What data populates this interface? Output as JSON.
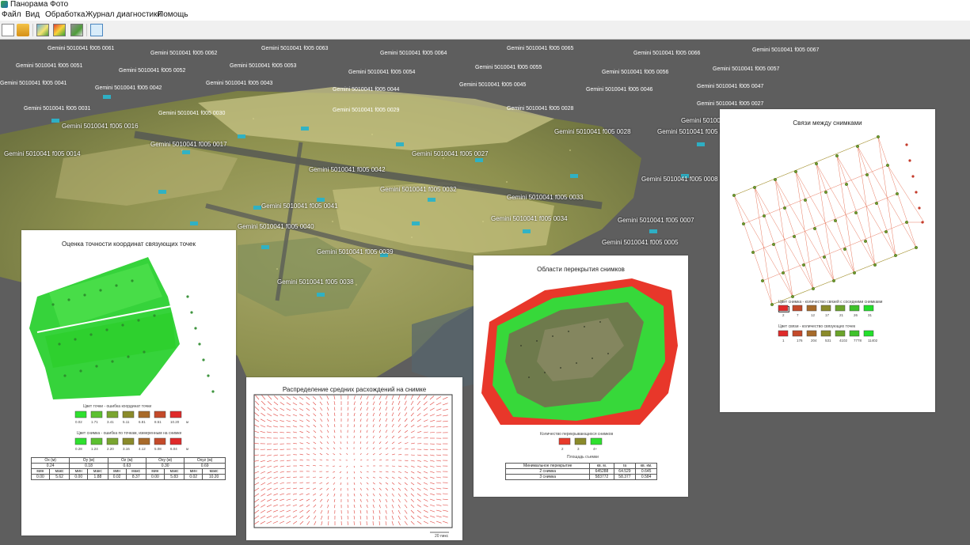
{
  "window": {
    "title": "Панорама Фото"
  },
  "menu": [
    "Файл",
    "Вид",
    "Обработка",
    "Журнал диагностики",
    "Помощь"
  ],
  "toolbar": {
    "icons": [
      "new-document-icon",
      "open-folder-icon",
      "image-tool-icon",
      "color-map-icon",
      "image-process-icon",
      "window-icon"
    ]
  },
  "scene": {
    "camera_labels": [
      "Gemini 5010041 f005 0041",
      "Gemini 5010041 f005 0042",
      "Gemini 5010041 f005 0040",
      "Gemini 5010041 f005 0039",
      "Gemini 5010041 f005 0038",
      "Gemini 5010041 f005 0032",
      "Gemini 5010041 f005 0033",
      "Gemini 5010041 f005 0034",
      "Gemini 5010041 f005 0007",
      "Gemini 5010041 f005 0006",
      "Gemini 5010041 f005 0005",
      "Gemini 5010041 f005 0008",
      "Gemini 5010041 f005 0027",
      "Gemini 5010041 f005 0028",
      "Gemini 5010041 f005 0029",
      "Gemini 5010041 f005 0016",
      "Gemini 5010041 f005 0017",
      "Gemini 5010041 f005 0018",
      "Gemini 5010041 f005 0014",
      "Gemini 5010041 f005 0013"
    ]
  },
  "report_links": {
    "title": "Связи между снимками",
    "legend1_caption": "Цвет снимка - количество связей с соседними снимками",
    "legend1_colors": [
      "#e02a2a",
      "#c44a2a",
      "#a66a2a",
      "#8a8a2a",
      "#6aa42a",
      "#3ec22a",
      "#22e02a"
    ],
    "legend1_values": [
      "2",
      "7",
      "12",
      "17",
      "21",
      "26",
      "31"
    ],
    "legend2_caption": "Цвет связи - количество связующих точек",
    "legend2_colors": [
      "#e02a2a",
      "#c44a2a",
      "#a66a2a",
      "#8a8a2a",
      "#6aa42a",
      "#3ec22a",
      "#22e02a"
    ],
    "legend2_values": [
      "1",
      "176",
      "204",
      "531",
      "4102",
      "7778",
      "11402"
    ]
  },
  "report_accuracy": {
    "title": "Оценка точности координат связующих точек",
    "legend1_caption": "Цвет точки - ошибка координат точки",
    "legend1_colors": [
      "#2ee02e",
      "#5cc030",
      "#7aa530",
      "#8a8a2a",
      "#a86a2a",
      "#c44a2a",
      "#e02a2a"
    ],
    "legend1_values": [
      "0.02",
      "1.71",
      "3.41",
      "5.11",
      "6.81",
      "8.51",
      "10.20",
      "м"
    ],
    "legend2_caption": "Цвет снимка - ошибка по точкам, измеренным на снимке",
    "legend2_colors": [
      "#2ee02e",
      "#5cc030",
      "#7aa530",
      "#8a8a2a",
      "#a86a2a",
      "#c44a2a",
      "#e02a2a"
    ],
    "legend2_values": [
      "0.28",
      "1.24",
      "2.20",
      "3.16",
      "4.12",
      "5.08",
      "6.04",
      "м"
    ],
    "table": {
      "header": [
        "Ox (м)",
        "Oy (м)",
        "Oz (м)",
        "Oxy (м)",
        "Oxyz (м)"
      ],
      "row1": [
        "0.24",
        "0.18",
        "0.63",
        "0.30",
        "0.69"
      ],
      "minmax_labels": [
        "мин",
        "макс",
        "мин",
        "макс",
        "мин",
        "макс",
        "мин",
        "макс",
        "мин",
        "макс"
      ],
      "row2": [
        "0.00",
        "5.62",
        "0.00",
        "1.88",
        "0.02",
        "8.37",
        "0.00",
        "5.83",
        "0.02",
        "10.20"
      ]
    }
  },
  "report_residuals": {
    "title": "Распределение средних расхождений на снимке",
    "scale_label": "20 пикс"
  },
  "report_overlap": {
    "title": "Области перекрытия снимков",
    "legend_caption": "Количество перекрывающихся снимков",
    "legend_colors": [
      "#e83a2a",
      "#8a8a2a",
      "#2ee02e"
    ],
    "legend_values": [
      "2",
      "3",
      "4+"
    ],
    "area_caption": "Площадь съемки",
    "table": {
      "header": [
        "Минимальное перекрытие",
        "кв. м.",
        "га",
        "кв. км."
      ],
      "rows": [
        [
          "2 снимка",
          "645288",
          "64.529",
          "0.645"
        ],
        [
          "3 снимка",
          "583772",
          "58.377",
          "0.584"
        ]
      ]
    }
  }
}
